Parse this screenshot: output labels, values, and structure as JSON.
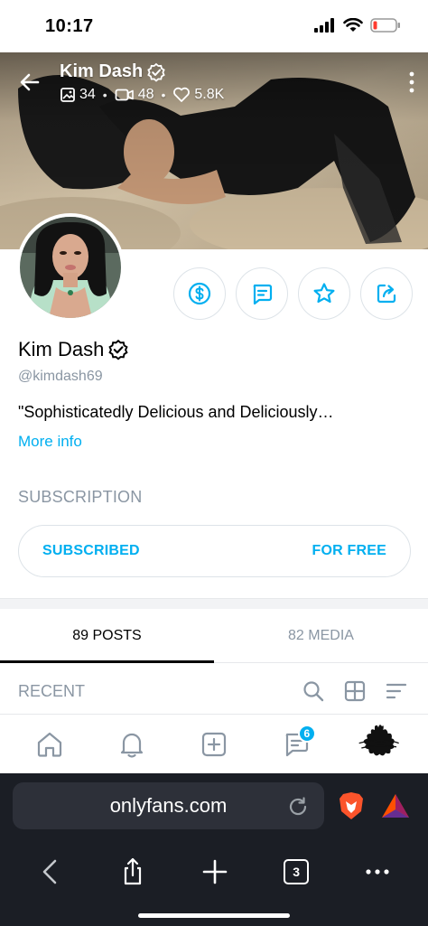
{
  "status": {
    "time": "10:17"
  },
  "cover": {
    "name": "Kim Dash",
    "photos_count": "34",
    "videos_count": "48",
    "likes_count": "5.8K"
  },
  "profile": {
    "name": "Kim Dash",
    "handle": "@kimdash69",
    "bio": "\"Sophisticatedly Delicious and Deliciously…",
    "more_info": "More info"
  },
  "subscription": {
    "title": "SUBSCRIPTION",
    "status_label": "SUBSCRIBED",
    "price_label": "FOR FREE"
  },
  "tabs": [
    {
      "label": "89 POSTS",
      "active": true
    },
    {
      "label": "82 MEDIA",
      "active": false
    }
  ],
  "recent": {
    "label": "RECENT"
  },
  "app_nav": {
    "items": [
      "home-icon",
      "bell-icon",
      "add-post-icon",
      "messages-icon",
      "profile-icon"
    ],
    "messages_badge": "6"
  },
  "browser": {
    "url": "onlyfans.com",
    "tab_count": "3"
  },
  "colors": {
    "accent": "#00aff0",
    "muted": "#8a96a3",
    "browser_bg": "#1b1e25"
  }
}
